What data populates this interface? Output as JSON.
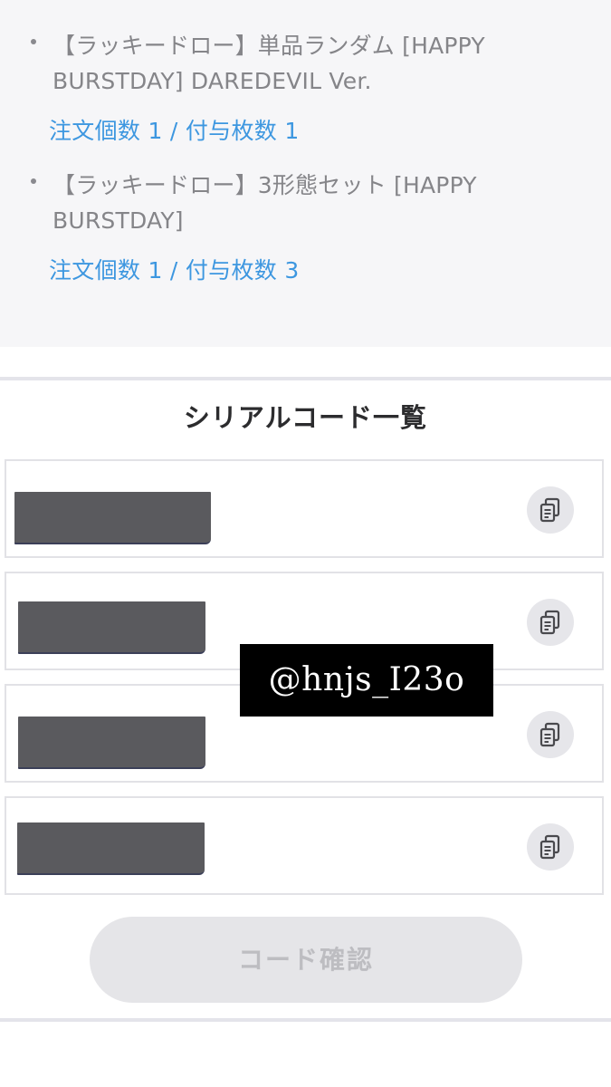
{
  "order": {
    "items": [
      {
        "name_line1": "【ラッキードロー】単品ランダム [HAPPY",
        "name_line2": "BURSTDAY] DAREDEVIL Ver.",
        "quantity": "注文個数 1 / 付与枚数 1"
      },
      {
        "name_line1": "【ラッキードロー】3形態セット [HAPPY",
        "name_line2": "BURSTDAY]",
        "quantity": "注文個数 1 / 付与枚数 3"
      }
    ]
  },
  "serials": {
    "title": "シリアルコード一覧",
    "codes": [
      {
        "copy_icon": "copy-icon"
      },
      {
        "copy_icon": "copy-icon"
      },
      {
        "copy_icon": "copy-icon"
      },
      {
        "copy_icon": "copy-icon"
      }
    ]
  },
  "watermark": "@hnjs_I23o",
  "confirm_button": "コード確認",
  "colors": {
    "panel_bg": "#f6f6f8",
    "item_text": "#858589",
    "quantity_text": "#3d97e0",
    "redaction": "#5a5a5e",
    "button_bg": "#e5e5e8",
    "button_text": "#bdbdc1"
  }
}
